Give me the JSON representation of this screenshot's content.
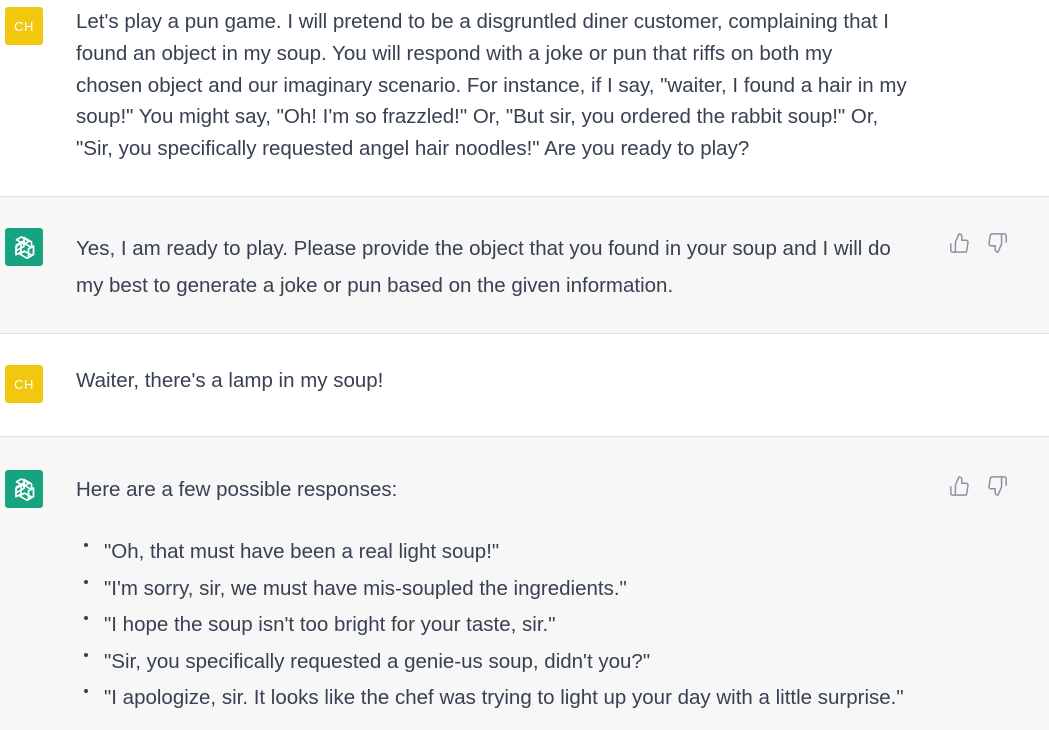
{
  "colors": {
    "user_avatar_bg": "#f2c80f",
    "assistant_avatar_bg": "#16a37f",
    "assistant_row_bg": "#f7f7f8",
    "text": "#374151"
  },
  "messages": [
    {
      "role": "user",
      "avatar_initials": "CH",
      "lines": [
        "Let's play a pun game. I will pretend to be a disgruntled diner customer, complaining that I",
        "found an object in my soup. You will respond with a joke or pun that riffs on both my",
        "chosen object and our imaginary scenario. For instance, if I say, \"waiter, I found a hair in my",
        "soup!\" You might say, \"Oh! I'm so frazzled!\" Or, \"But sir, you ordered the rabbit soup!\" Or,",
        "\"Sir, you specifically requested angel hair noodles!\" Are you ready to play?"
      ]
    },
    {
      "role": "assistant",
      "avatar_icon": "openai-logo-icon",
      "lines": [
        "Yes, I am ready to play. Please provide the object that you found in your soup and I will do",
        "my best to generate a joke or pun based on the given information."
      ],
      "feedback_icons": [
        "thumbs-up-icon",
        "thumbs-down-icon"
      ]
    },
    {
      "role": "user",
      "avatar_initials": "CH",
      "lines": [
        "Waiter, there's a lamp in my soup!"
      ]
    },
    {
      "role": "assistant",
      "avatar_icon": "openai-logo-icon",
      "intro": "Here are a few possible responses:",
      "bullets": [
        "\"Oh, that must have been a real light soup!\"",
        "\"I'm sorry, sir, we must have mis-soupled the ingredients.\"",
        "\"I hope the soup isn't too bright for your taste, sir.\"",
        "\"Sir, you specifically requested a genie-us soup, didn't you?\"",
        "\"I apologize, sir. It looks like the chef was trying to light up your day with a little surprise.\""
      ],
      "feedback_icons": [
        "thumbs-up-icon",
        "thumbs-down-icon"
      ]
    }
  ]
}
